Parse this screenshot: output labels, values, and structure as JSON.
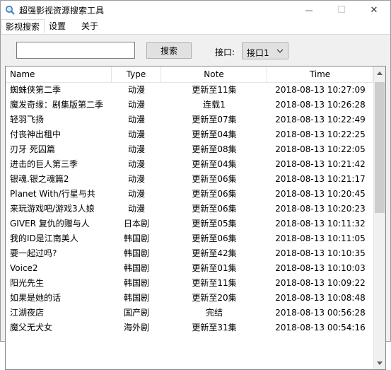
{
  "window": {
    "title": "超强影视资源搜索工具",
    "min_glyph": "—",
    "max_glyph": "☐",
    "close_glyph": "✕"
  },
  "tabs": [
    {
      "label": "影视搜索"
    },
    {
      "label": "设置"
    },
    {
      "label": "关于"
    }
  ],
  "search": {
    "value": "",
    "button_label": "搜索",
    "port_label": "接口:",
    "port_value": "接口1"
  },
  "table": {
    "columns": [
      "Name",
      "Type",
      "Note",
      "Time"
    ],
    "rows": [
      {
        "name": "蜘蛛侠第二季",
        "type": "动漫",
        "note": "更新至11集",
        "time": "2018-08-13 10:27:09"
      },
      {
        "name": "魔发奇缘：剧集版第二季",
        "type": "动漫",
        "note": "连载1",
        "time": "2018-08-13 10:26:28"
      },
      {
        "name": "轻羽飞扬",
        "type": "动漫",
        "note": "更新至07集",
        "time": "2018-08-13 10:22:49"
      },
      {
        "name": "付丧神出租中",
        "type": "动漫",
        "note": "更新至04集",
        "time": "2018-08-13 10:22:25"
      },
      {
        "name": "刃牙 死囚篇",
        "type": "动漫",
        "note": "更新至08集",
        "time": "2018-08-13 10:22:05"
      },
      {
        "name": "进击的巨人第三季",
        "type": "动漫",
        "note": "更新至04集",
        "time": "2018-08-13 10:21:42"
      },
      {
        "name": "银魂.银之魂篇2",
        "type": "动漫",
        "note": "更新至06集",
        "time": "2018-08-13 10:21:17"
      },
      {
        "name": "Planet With/行星与共",
        "type": "动漫",
        "note": "更新至06集",
        "time": "2018-08-13 10:20:45"
      },
      {
        "name": "来玩游戏吧/游戏3人娘",
        "type": "动漫",
        "note": "更新至06集",
        "time": "2018-08-13 10:20:23"
      },
      {
        "name": "GIVER 复仇的赠与人",
        "type": "日本剧",
        "note": "更新至05集",
        "time": "2018-08-13 10:11:32"
      },
      {
        "name": "我的ID是江南美人",
        "type": "韩国剧",
        "note": "更新至06集",
        "time": "2018-08-13 10:11:05"
      },
      {
        "name": "要一起过吗?",
        "type": "韩国剧",
        "note": "更新至42集",
        "time": "2018-08-13 10:10:35"
      },
      {
        "name": "Voice2",
        "type": "韩国剧",
        "note": "更新至01集",
        "time": "2018-08-13 10:10:03"
      },
      {
        "name": "阳光先生",
        "type": "韩国剧",
        "note": "更新至11集",
        "time": "2018-08-13 10:09:22"
      },
      {
        "name": "如果是她的话",
        "type": "韩国剧",
        "note": "更新至20集",
        "time": "2018-08-13 10:08:48"
      },
      {
        "name": "江湖夜店",
        "type": "国产剧",
        "note": "完结",
        "time": "2018-08-13 00:56:28"
      },
      {
        "name": "魔父无犬女",
        "type": "海外剧",
        "note": "更新至31集",
        "time": "2018-08-13 00:54:16"
      }
    ]
  },
  "colors": {
    "content_bg": "#f0f0f0",
    "button_bg": "#e1e1e1",
    "scroll_thumb": "#cdcdcd"
  }
}
